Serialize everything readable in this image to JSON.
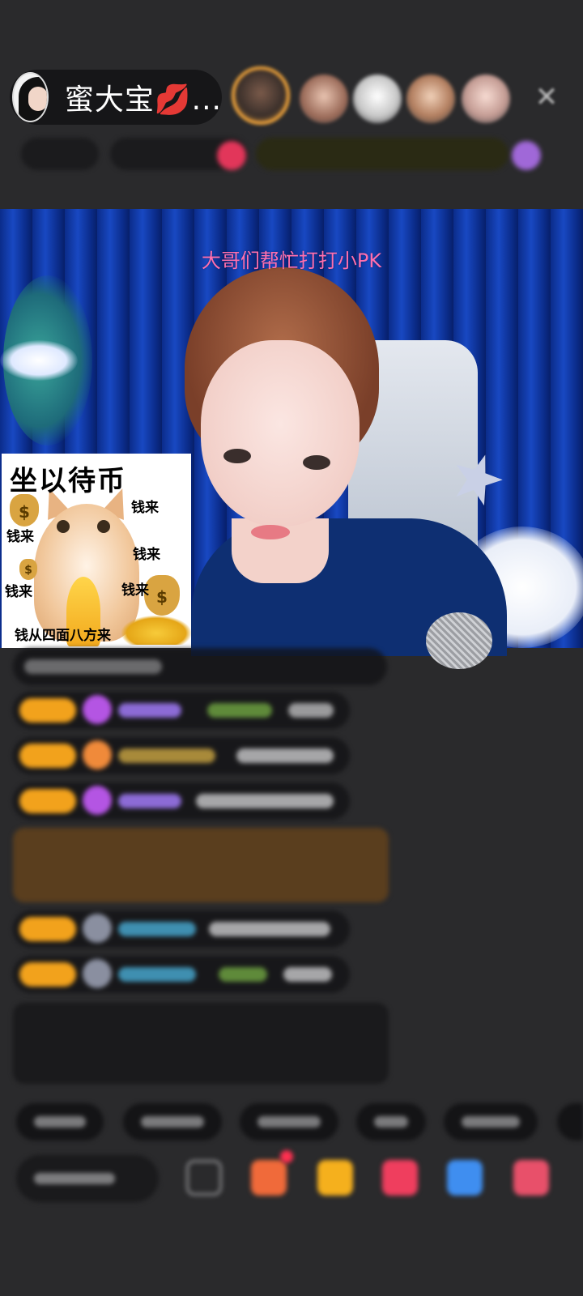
{
  "streamer": {
    "name": "蜜大宝💋..."
  },
  "video": {
    "overlay_text": "大哥们帮忙打打小PK"
  },
  "sticker": {
    "title": "坐以待币",
    "labels": [
      "钱来",
      "钱来",
      "钱来",
      "钱来",
      "钱来"
    ],
    "footer": "钱从四面八方来",
    "bag_symbol": "$"
  },
  "colors": {
    "background": "#2a2a2c",
    "overlay_text": "#ff6fae",
    "badge": "#f2a21c",
    "top_viewer_ring": "#f2a53b"
  },
  "icons": {
    "close": "✕"
  }
}
